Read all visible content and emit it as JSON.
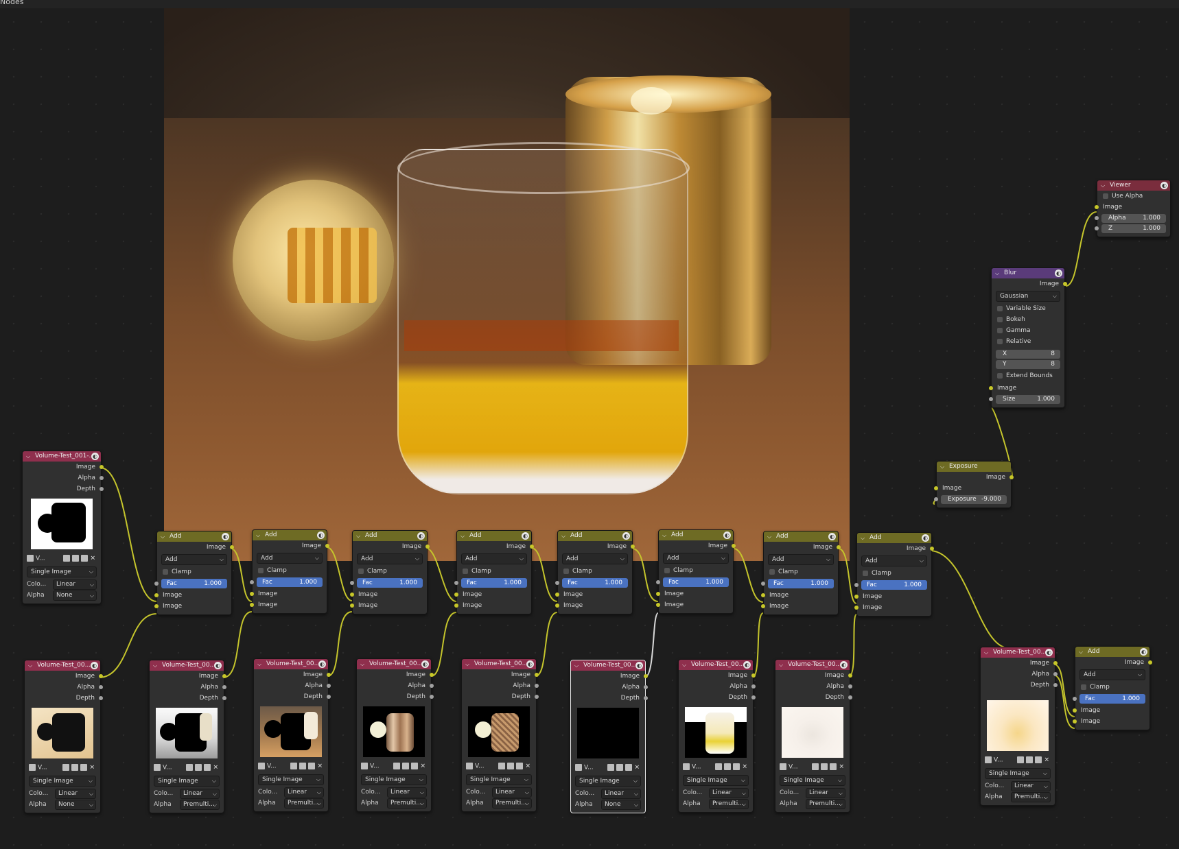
{
  "editor": {
    "title": "Nodes"
  },
  "viewer": {
    "title": "Viewer",
    "use_alpha": "Use Alpha",
    "image": "Image",
    "alpha_label": "Alpha",
    "alpha_value": "1.000",
    "z_label": "Z",
    "z_value": "1.000"
  },
  "blur": {
    "title": "Blur",
    "out": "Image",
    "filter": "Gaussian",
    "opts": [
      "Variable Size",
      "Bokeh",
      "Gamma",
      "Relative"
    ],
    "x_label": "X",
    "x_value": "8",
    "y_label": "Y",
    "y_value": "8",
    "extend": "Extend Bounds",
    "in": "Image",
    "size_label": "Size",
    "size_value": "1.000"
  },
  "exposure": {
    "title": "Exposure",
    "out": "Image",
    "in": "Image",
    "exp_label": "Exposure",
    "exp_value": "-9.000"
  },
  "mix": {
    "title": "Add",
    "out": "Image",
    "blend": "Add",
    "clamp": "Clamp",
    "fac_label": "Fac",
    "fac_value": "1.000",
    "in1": "Image",
    "in2": "Image"
  },
  "image_node": {
    "out_image": "Image",
    "out_alpha": "Alpha",
    "out_depth": "Depth",
    "v_label": "V...",
    "source": "Single Image",
    "color_label": "Colo...",
    "color_label_alt": "Color...",
    "color_space": "Linear",
    "alpha_label": "Alpha",
    "alpha_none": "None",
    "alpha_premult": "Premulti..."
  },
  "image_nodes": [
    {
      "title": "Volume-Test_001-..."
    },
    {
      "title": "Volume-Test_00..."
    }
  ]
}
